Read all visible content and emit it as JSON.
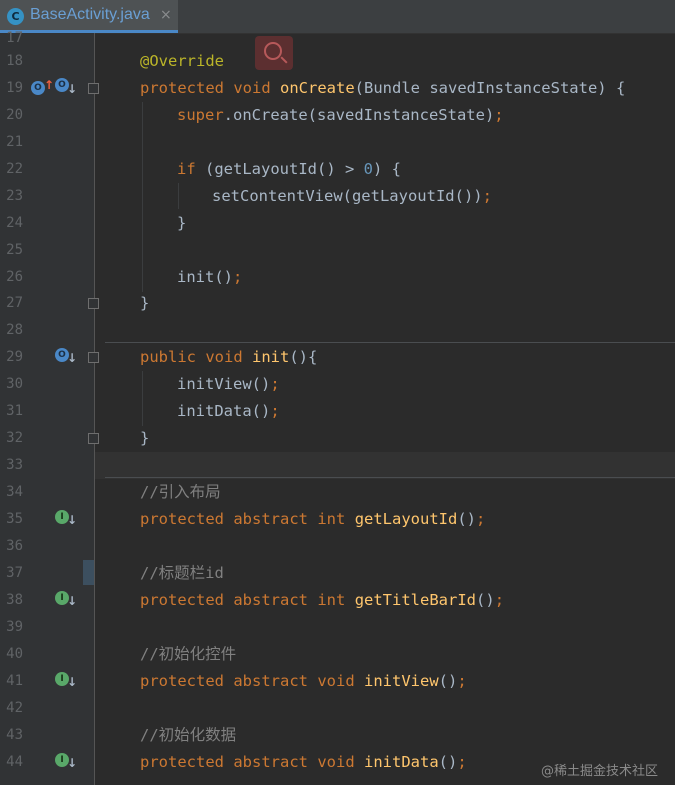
{
  "tab": {
    "title": "BaseActivity.java",
    "icon_letter": "C",
    "close_glyph": "×"
  },
  "lines": {
    "l17": "17",
    "l18": "18",
    "l19": "19",
    "l20": "20",
    "l21": "21",
    "l22": "22",
    "l23": "23",
    "l24": "24",
    "l25": "25",
    "l26": "26",
    "l27": "27",
    "l28": "28",
    "l29": "29",
    "l30": "30",
    "l31": "31",
    "l32": "32",
    "l33": "33",
    "l34": "34",
    "l35": "35",
    "l36": "36",
    "l37": "37",
    "l38": "38",
    "l39": "39",
    "l40": "40",
    "l41": "41",
    "l42": "42",
    "l43": "43",
    "l44": "44"
  },
  "code": {
    "override": "@Override",
    "kw_protected": "protected",
    "kw_void": "void",
    "kw_public": "public",
    "kw_abstract": "abstract",
    "kw_int": "int",
    "kw_super": "super",
    "kw_if": "if",
    "on_create": "onCreate",
    "on_create_params": "(Bundle savedInstanceState) {",
    "super_call": ".onCreate(savedInstanceState)",
    "semi": ";",
    "if_open": " (getLayoutId() > ",
    "zero": "0",
    "if_close": ") {",
    "set_content": "setContentView(getLayoutId())",
    "close_brace": "}",
    "init_call": "init()",
    "init_name": "init",
    "init_open": "(){",
    "init_view_call": "initView()",
    "init_data_call": "initData()",
    "comment_layout": "//引入布局",
    "get_layout_id": "getLayoutId",
    "parens": "()",
    "comment_titlebar": "//标题栏id",
    "get_titlebar_id": "getTitleBarId",
    "comment_init_view": "//初始化控件",
    "init_view_name": "initView",
    "comment_init_data": "//初始化数据",
    "init_data_name": "initData"
  },
  "gutter_icons": {
    "override_letter": "O",
    "implement_letter": "I",
    "up_arrow": "↑",
    "down_arrow": "↓"
  },
  "colors": {
    "keyword": "#cc7832",
    "function": "#ffc66d",
    "annotation": "#bbb529",
    "number": "#6897bb",
    "comment": "#808080",
    "text": "#a9b7c6",
    "background": "#2b2b2b"
  },
  "watermark": "@稀土掘金技术社区"
}
